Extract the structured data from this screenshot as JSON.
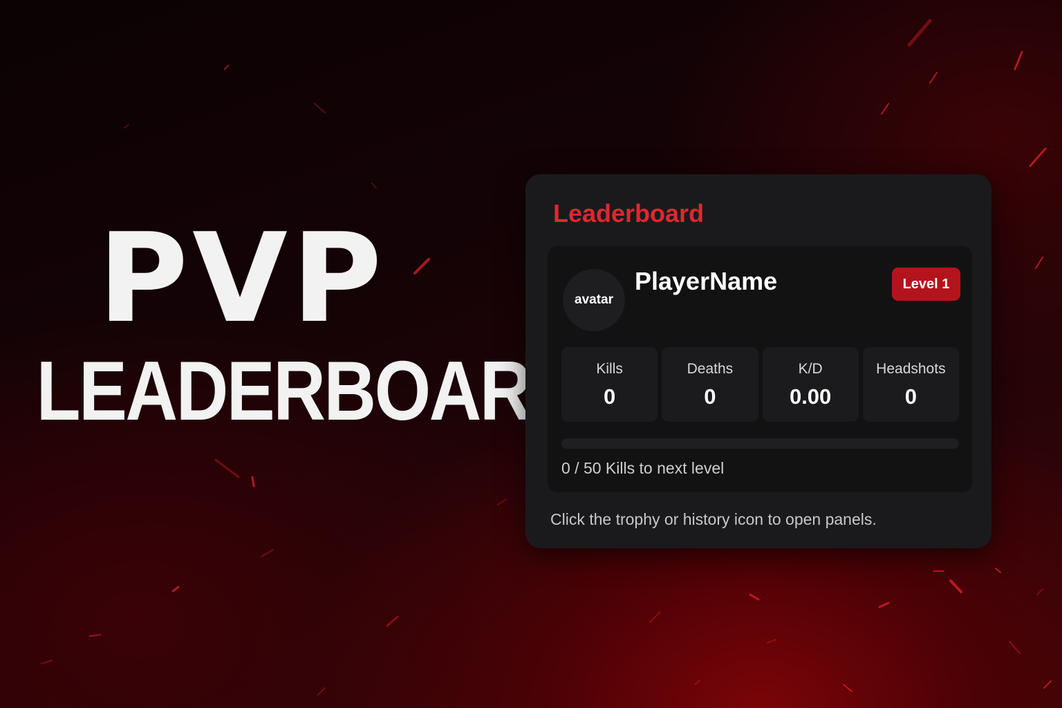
{
  "hero": {
    "line1": "PVP",
    "line2": "LEADERBOARD"
  },
  "card": {
    "title": "Leaderboard",
    "player": {
      "avatar_label": "avatar",
      "name": "PlayerName",
      "level_badge": "Level 1"
    },
    "stats": [
      {
        "label": "Kills",
        "value": "0"
      },
      {
        "label": "Deaths",
        "value": "0"
      },
      {
        "label": "K/D",
        "value": "0.00"
      },
      {
        "label": "Headshots",
        "value": "0"
      }
    ],
    "progress": {
      "fraction": 0,
      "text": "0 / 50 Kills to next level"
    },
    "hint": "Click the trophy or history icon to open panels."
  },
  "colors": {
    "accent": "#e32630",
    "badge": "#b3141c",
    "card_bg": "#1a1a1c",
    "inner_bg": "#121213"
  }
}
